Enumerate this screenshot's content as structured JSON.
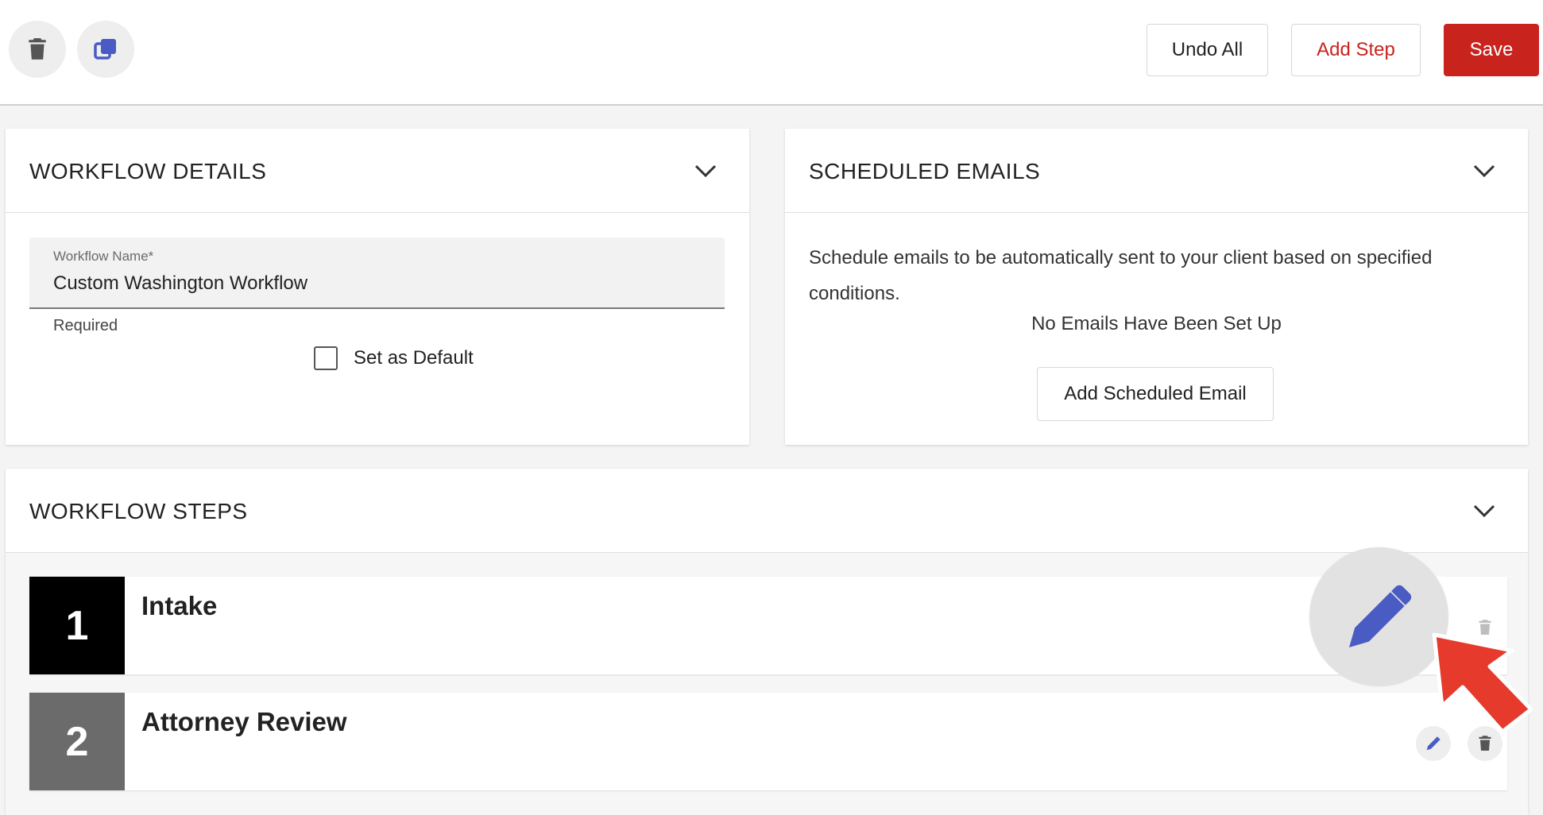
{
  "toolbar": {
    "undo_all_label": "Undo All",
    "add_step_label": "Add Step",
    "save_label": "Save"
  },
  "workflow_details": {
    "title": "WORKFLOW DETAILS",
    "name_field": {
      "label": "Workflow Name*",
      "value": "Custom Washington Workflow",
      "helper": "Required"
    },
    "set_default": {
      "label": "Set as Default",
      "checked": false
    }
  },
  "scheduled_emails": {
    "title": "SCHEDULED EMAILS",
    "description": "Schedule emails to be automatically sent to your client based on specified conditions.",
    "empty_text": "No Emails Have Been Set Up",
    "add_button_label": "Add Scheduled Email"
  },
  "workflow_steps": {
    "title": "WORKFLOW STEPS",
    "steps": [
      {
        "number": "1",
        "name": "Intake",
        "badge_color": "#000000"
      },
      {
        "number": "2",
        "name": "Attorney Review",
        "badge_color": "#6b6b6b"
      }
    ]
  },
  "colors": {
    "accent_red": "#c9231e",
    "icon_blue": "#4a5bc4",
    "icon_gray": "#555555",
    "callout_arrow": "#e53a2c"
  },
  "icons": {
    "toolbar_delete": "trash-icon",
    "toolbar_duplicate": "copy-icon",
    "collapse": "chevron-down-icon",
    "step_edit": "pencil-icon",
    "step_delete": "trash-icon"
  }
}
